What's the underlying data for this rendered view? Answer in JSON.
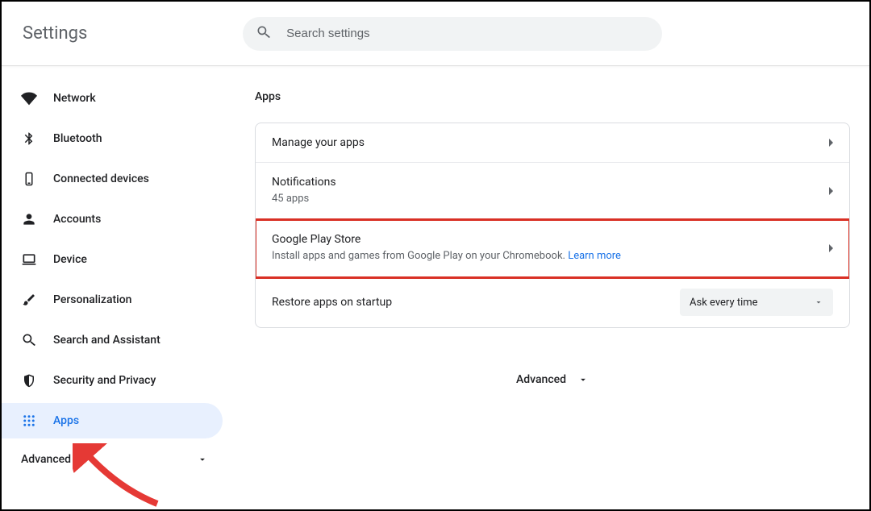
{
  "header": {
    "title": "Settings",
    "search_placeholder": "Search settings"
  },
  "sidebar": {
    "items": [
      {
        "label": "Network",
        "icon": "wifi"
      },
      {
        "label": "Bluetooth",
        "icon": "bluetooth"
      },
      {
        "label": "Connected devices",
        "icon": "phone"
      },
      {
        "label": "Accounts",
        "icon": "person"
      },
      {
        "label": "Device",
        "icon": "laptop"
      },
      {
        "label": "Personalization",
        "icon": "brush"
      },
      {
        "label": "Search and Assistant",
        "icon": "search"
      },
      {
        "label": "Security and Privacy",
        "icon": "shield"
      },
      {
        "label": "Apps",
        "icon": "apps"
      }
    ],
    "advanced_label": "Advanced"
  },
  "main": {
    "section_title": "Apps",
    "rows": {
      "manage": {
        "title": "Manage your apps"
      },
      "notifications": {
        "title": "Notifications",
        "sub": "45 apps"
      },
      "play": {
        "title": "Google Play Store",
        "sub": "Install apps and games from Google Play on your Chromebook. ",
        "learn": "Learn more"
      },
      "restore": {
        "title": "Restore apps on startup",
        "value": "Ask every time"
      }
    },
    "advanced_toggle": "Advanced"
  }
}
